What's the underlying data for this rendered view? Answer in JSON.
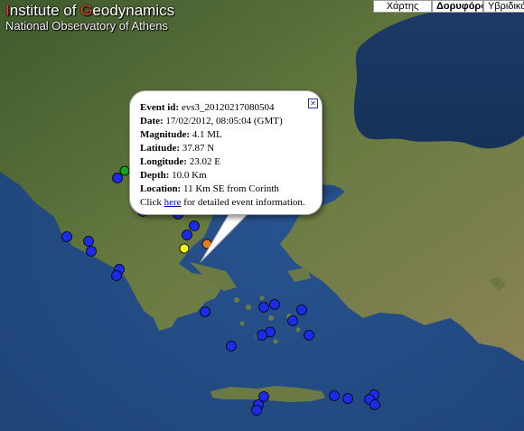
{
  "header": {
    "title_first": "I",
    "title_part2": "nstitute of ",
    "title_g": "G",
    "title_part3": "eodynamics",
    "subtitle": "National Observatory of Athens"
  },
  "map_types": [
    {
      "label": "Χάρτης",
      "active": false
    },
    {
      "label": "Δορυφόρος",
      "active": true
    },
    {
      "label": "Υβριδικός",
      "active": false
    }
  ],
  "popup": {
    "event_id_label": "Event id:",
    "event_id": " evs3_20120217080504",
    "date_label": "Date:",
    "date": " 17/02/2012, 08:05:04 (GMT)",
    "magnitude_label": "Magnitude:",
    "magnitude": " 4.1 ML",
    "latitude_label": "Latitude:",
    "latitude": " 37.87 N",
    "longitude_label": "Longitude:",
    "longitude": " 23.02 E",
    "depth_label": "Depth:",
    "depth": " 10.0 Km",
    "location_label": "Location:",
    "location": " 11 Km SE from Corinth",
    "click_prefix": "Click ",
    "click_link": "here",
    "click_suffix": " for detailed event information.",
    "close_symbol": "✕"
  },
  "colors": {
    "sea": "#2a4f8b",
    "land": "#5a7338",
    "marker_blue": "#1b2be8"
  },
  "markers": [
    {
      "lon": 22.04,
      "lat": 40.22,
      "color": "yellow"
    },
    {
      "lon": 21.78,
      "lat": 40.02,
      "color": "green"
    },
    {
      "lon": 21.62,
      "lat": 39.86,
      "color": "blue"
    },
    {
      "lon": 22.7,
      "lat": 39.55,
      "color": "orange"
    },
    {
      "lon": 22.36,
      "lat": 39.4,
      "color": "green"
    },
    {
      "lon": 22.46,
      "lat": 39.36,
      "color": "blue"
    },
    {
      "lon": 22.56,
      "lat": 39.4,
      "color": "blue"
    },
    {
      "lon": 22.26,
      "lat": 39.26,
      "color": "blue"
    },
    {
      "lon": 22.18,
      "lat": 39.12,
      "color": "blue"
    },
    {
      "lon": 22.96,
      "lat": 39.06,
      "color": "blue"
    },
    {
      "lon": 23.32,
      "lat": 38.8,
      "color": "blue"
    },
    {
      "lon": 23.16,
      "lat": 38.6,
      "color": "blue"
    },
    {
      "lon": 23.1,
      "lat": 38.3,
      "color": "yellow"
    },
    {
      "lon": 23.6,
      "lat": 38.4,
      "color": "orange"
    },
    {
      "lon": 20.5,
      "lat": 38.56,
      "color": "blue"
    },
    {
      "lon": 20.98,
      "lat": 38.46,
      "color": "blue"
    },
    {
      "lon": 21.04,
      "lat": 38.24,
      "color": "blue"
    },
    {
      "lon": 21.66,
      "lat": 37.84,
      "color": "blue"
    },
    {
      "lon": 21.6,
      "lat": 37.7,
      "color": "blue"
    },
    {
      "lon": 23.56,
      "lat": 36.9,
      "color": "blue"
    },
    {
      "lon": 24.86,
      "lat": 37.0,
      "color": "blue"
    },
    {
      "lon": 25.1,
      "lat": 37.06,
      "color": "blue"
    },
    {
      "lon": 25.7,
      "lat": 36.94,
      "color": "blue"
    },
    {
      "lon": 25.5,
      "lat": 36.7,
      "color": "blue"
    },
    {
      "lon": 25.0,
      "lat": 36.45,
      "color": "blue"
    },
    {
      "lon": 24.82,
      "lat": 36.38,
      "color": "blue"
    },
    {
      "lon": 25.86,
      "lat": 36.38,
      "color": "blue"
    },
    {
      "lon": 24.14,
      "lat": 36.14,
      "color": "blue"
    },
    {
      "lon": 24.86,
      "lat": 35.02,
      "color": "blue"
    },
    {
      "lon": 26.42,
      "lat": 35.04,
      "color": "blue"
    },
    {
      "lon": 26.72,
      "lat": 34.98,
      "color": "blue"
    },
    {
      "lon": 27.3,
      "lat": 35.06,
      "color": "blue"
    },
    {
      "lon": 27.2,
      "lat": 34.96,
      "color": "blue"
    },
    {
      "lon": 27.32,
      "lat": 34.84,
      "color": "blue"
    },
    {
      "lon": 24.74,
      "lat": 34.84,
      "color": "blue"
    },
    {
      "lon": 24.7,
      "lat": 34.72,
      "color": "blue"
    },
    {
      "lon": 23.82,
      "lat": 39.9,
      "color": "red"
    }
  ]
}
